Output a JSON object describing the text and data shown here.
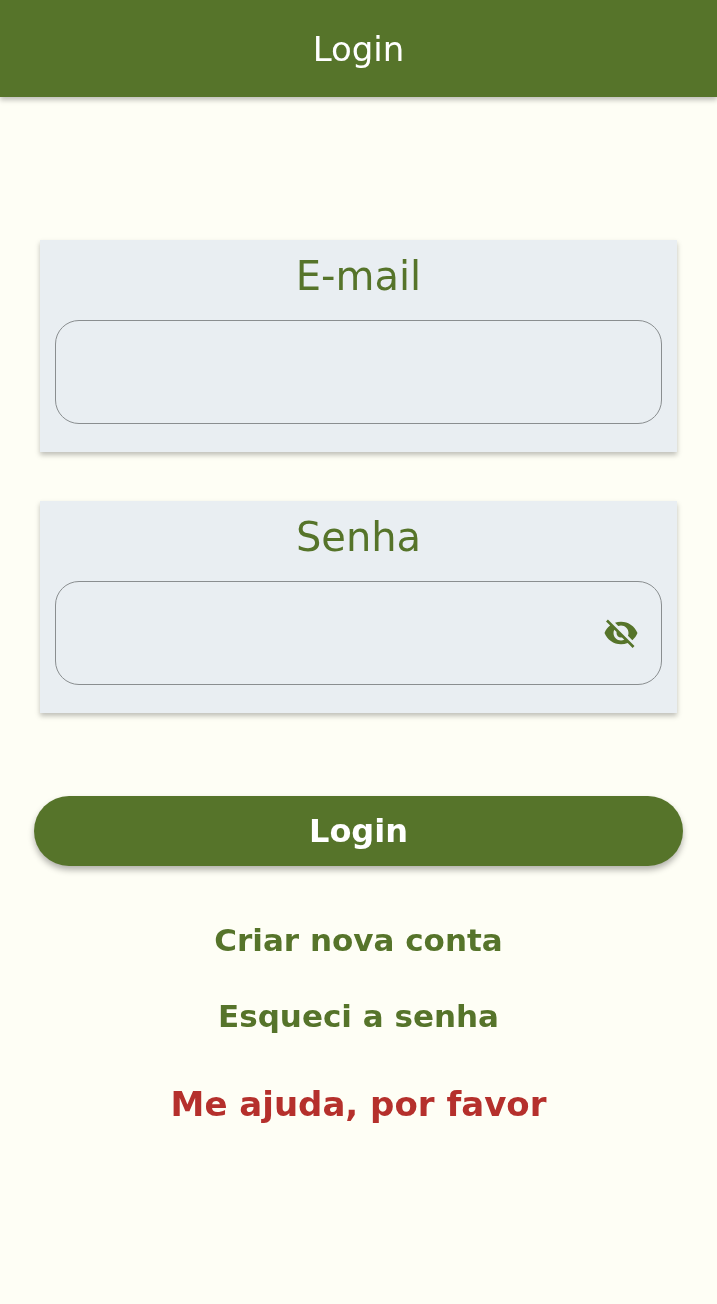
{
  "app_bar": {
    "title": "Login"
  },
  "fields": [
    {
      "label": "E-mail",
      "kind": "text"
    },
    {
      "label": "Senha",
      "kind": "password"
    }
  ],
  "login_button": {
    "label": "Login"
  },
  "links": [
    {
      "label": "Criar nova conta",
      "color": "#56742a"
    },
    {
      "label": "Esqueci a senha",
      "color": "#56742a"
    },
    {
      "label": "Me ajuda, por favor",
      "color": "#b5302c"
    }
  ]
}
